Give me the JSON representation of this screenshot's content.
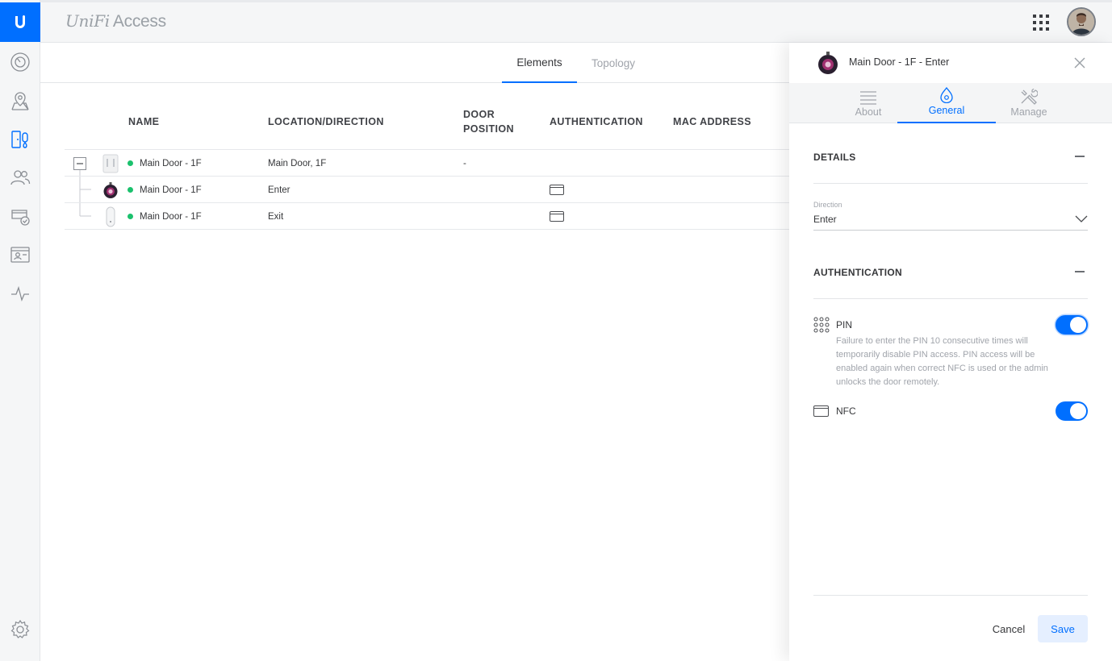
{
  "app": {
    "brand_unifi": "UniFi",
    "brand_product": "Access"
  },
  "sidebar": {
    "items": [
      {
        "name": "dashboard",
        "icon": "dashboard-gauge-icon"
      },
      {
        "name": "map",
        "icon": "map-pin-icon"
      },
      {
        "name": "devices",
        "icon": "door-devices-icon",
        "active": true
      },
      {
        "name": "users",
        "icon": "users-icon"
      },
      {
        "name": "access-policies",
        "icon": "shield-check-icon"
      },
      {
        "name": "visitors",
        "icon": "id-card-icon"
      },
      {
        "name": "activity",
        "icon": "activity-pulse-icon"
      },
      {
        "name": "settings",
        "icon": "gear-icon"
      }
    ]
  },
  "main": {
    "tabs": [
      {
        "label": "Elements",
        "active": true
      },
      {
        "label": "Topology",
        "active": false
      }
    ],
    "table": {
      "columns": [
        "NAME",
        "LOCATION/DIRECTION",
        "DOOR POSITION",
        "AUTHENTICATION",
        "MAC ADDRESS"
      ],
      "column_door_line1": "DOOR",
      "column_door_line2": "POSITION",
      "rows": [
        {
          "name": "Main Door - 1F",
          "location": "Main Door, 1F",
          "door_position": "-",
          "auth": "",
          "status": "online",
          "device": "hub"
        },
        {
          "name": "Main Door - 1F",
          "location": "Enter",
          "door_position": "",
          "auth": "nfc",
          "status": "online",
          "device": "reader-pro"
        },
        {
          "name": "Main Door - 1F",
          "location": "Exit",
          "door_position": "",
          "auth": "nfc",
          "status": "online",
          "device": "reader-lite"
        }
      ]
    }
  },
  "panel": {
    "title": "Main Door - 1F - Enter",
    "tabs": [
      {
        "label": "About",
        "icon": "list-icon"
      },
      {
        "label": "General",
        "icon": "drop-icon",
        "active": true
      },
      {
        "label": "Manage",
        "icon": "tools-icon"
      }
    ],
    "details": {
      "title": "DETAILS",
      "direction_label": "Direction",
      "direction_value": "Enter"
    },
    "authentication": {
      "title": "AUTHENTICATION",
      "pin_label": "PIN",
      "pin_description": "Failure to enter the PIN 10 consecutive times will temporarily disable PIN access. PIN access will be enabled again when correct NFC is used or the admin unlocks the door remotely.",
      "pin_enabled": true,
      "nfc_label": "NFC",
      "nfc_enabled": true
    },
    "cancel_label": "Cancel",
    "save_label": "Save"
  },
  "colors": {
    "accent": "#006fff",
    "online": "#1bc16d",
    "sidebar_bg": "#f5f6f7"
  }
}
